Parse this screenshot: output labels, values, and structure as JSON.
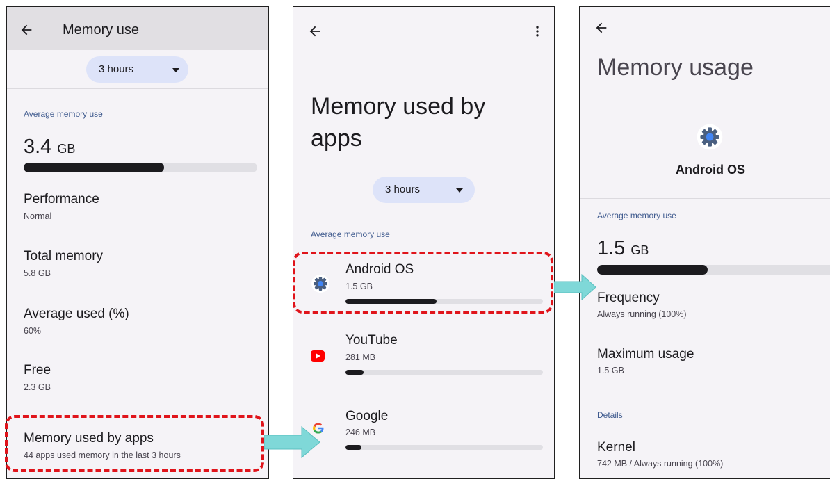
{
  "colors": {
    "accent": "#3f5a8e",
    "highlight": "#e0141b",
    "arrow": "#7fd8d8",
    "chip": "#dde3f9"
  },
  "screen1": {
    "title": "Memory use",
    "dropdown": "3 hours",
    "section_label": "Average memory use",
    "avg_value": "3.4",
    "avg_unit": "GB",
    "avg_fraction": 0.6,
    "items": [
      {
        "title": "Performance",
        "subtitle": "Normal"
      },
      {
        "title": "Total memory",
        "subtitle": "5.8 GB"
      },
      {
        "title": "Average used (%)",
        "subtitle": "60%"
      },
      {
        "title": "Free",
        "subtitle": "2.3 GB"
      },
      {
        "title": "Memory used by apps",
        "subtitle": "44 apps used memory in the last 3 hours"
      }
    ]
  },
  "screen2": {
    "title_line1": "Memory used by",
    "title_line2": "apps",
    "dropdown": "3 hours",
    "section_label": "Average memory use",
    "apps": [
      {
        "name": "Android OS",
        "value": "1.5 GB",
        "fraction": 0.46,
        "icon": "gear-icon"
      },
      {
        "name": "YouTube",
        "value": "281 MB",
        "fraction": 0.09,
        "icon": "youtube-icon"
      },
      {
        "name": "Google",
        "value": "246 MB",
        "fraction": 0.08,
        "icon": "google-icon"
      }
    ]
  },
  "screen3": {
    "title": "Memory usage",
    "app_name": "Android OS",
    "section_label": "Average memory use",
    "avg_value": "1.5",
    "avg_unit": "GB",
    "avg_fraction": 0.46,
    "items": [
      {
        "title": "Frequency",
        "subtitle": "Always running (100%)"
      },
      {
        "title": "Maximum usage",
        "subtitle": "1.5 GB"
      }
    ],
    "details_label": "Details",
    "details": [
      {
        "title": "Kernel",
        "subtitle": "742 MB / Always running (100%)"
      }
    ]
  }
}
